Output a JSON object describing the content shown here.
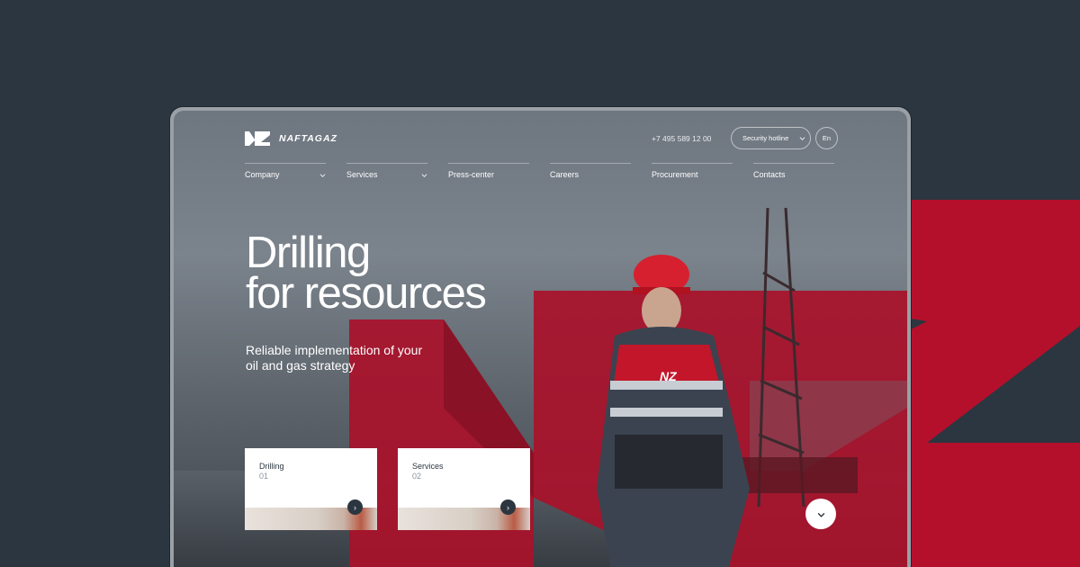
{
  "brand": {
    "name": "NAFTAGAZ",
    "mark": "NZ"
  },
  "header": {
    "phone": "+7 495 589 12 00",
    "hotline_label": "Security hotline",
    "lang_label": "En"
  },
  "nav": {
    "items": [
      {
        "label": "Company",
        "has_dropdown": true
      },
      {
        "label": "Services",
        "has_dropdown": true
      },
      {
        "label": "Press-center",
        "has_dropdown": false
      },
      {
        "label": "Careers",
        "has_dropdown": false
      },
      {
        "label": "Procurement",
        "has_dropdown": false
      },
      {
        "label": "Contacts",
        "has_dropdown": false
      }
    ]
  },
  "hero": {
    "title_line1": "Drilling",
    "title_line2": "for resources",
    "subtitle_line1": "Reliable implementation of your",
    "subtitle_line2": "oil and gas strategy"
  },
  "cards": [
    {
      "title": "Drilling",
      "num": "01"
    },
    {
      "title": "Services",
      "num": "02"
    }
  ],
  "colors": {
    "accent": "#b5102b",
    "dark": "#2b3640",
    "white": "#ffffff"
  },
  "icons": {
    "chevron": "chevron-down-icon",
    "arrow": "arrow-right-icon",
    "scroll": "chevron-down-icon"
  }
}
